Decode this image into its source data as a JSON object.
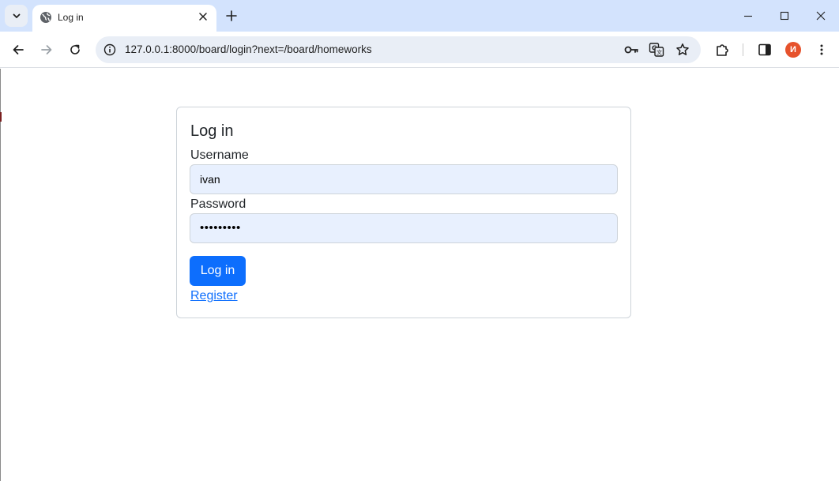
{
  "browser": {
    "tab": {
      "title": "Log in",
      "favicon": "globe-icon"
    },
    "url": "127.0.0.1:8000/board/login?next=/board/homeworks",
    "profile_initial": "И",
    "profile_color": "#e6522c"
  },
  "icons": {
    "tab_search": "chevron-down-icon",
    "tab_close": "close-icon",
    "new_tab": "plus-icon",
    "back": "arrow-left-icon",
    "forward": "arrow-right-icon",
    "reload": "reload-icon",
    "site_info": "info-icon",
    "password": "key-icon",
    "translate": "translate-icon",
    "bookmark": "star-icon",
    "extensions": "puzzle-icon",
    "side_panel": "side-panel-icon",
    "menu": "kebab-menu-icon",
    "minimize": "minimize-icon",
    "maximize": "maximize-icon",
    "close_window": "close-icon"
  },
  "page": {
    "title": "Log in",
    "username_label": "Username",
    "username_value": "ivan",
    "password_label": "Password",
    "password_value": "•••••••••",
    "submit_label": "Log in",
    "register_link": "Register"
  },
  "colors": {
    "accent": "#0d6efd",
    "autofill_bg": "#e8f0fe",
    "tabstrip_bg": "#d3e3fd"
  }
}
